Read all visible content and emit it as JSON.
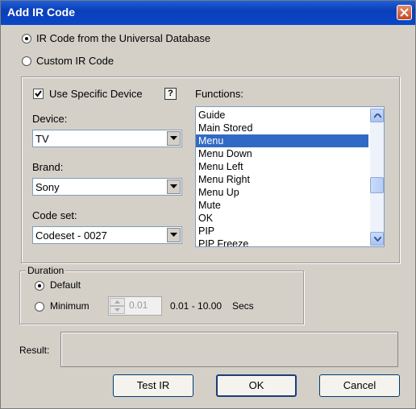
{
  "window": {
    "title": "Add IR Code"
  },
  "source": {
    "universal_label": "IR Code from the Universal Database",
    "custom_label": "Custom IR Code",
    "selected": "universal"
  },
  "device_panel": {
    "use_specific_label": "Use Specific Device",
    "use_specific_checked": true,
    "help_label": "?",
    "device_label": "Device:",
    "device_value": "TV",
    "brand_label": "Brand:",
    "brand_value": "Sony",
    "codeset_label": "Code set:",
    "codeset_value": "Codeset - 0027",
    "functions_label": "Functions:",
    "functions": [
      "Guide",
      "Main Stored",
      "Menu",
      "Menu Down",
      "Menu Left",
      "Menu Right",
      "Menu Up",
      "Mute",
      "OK",
      "PIP",
      "PIP Freeze"
    ],
    "selected_function": "Menu"
  },
  "duration": {
    "group_label": "Duration",
    "default_label": "Default",
    "minimum_label": "Minimum",
    "minimum_value": "0.01",
    "range_text": "0.01 - 10.00",
    "unit": "Secs",
    "selected": "default"
  },
  "result": {
    "label": "Result:",
    "value": ""
  },
  "buttons": {
    "test": "Test IR",
    "ok": "OK",
    "cancel": "Cancel"
  }
}
